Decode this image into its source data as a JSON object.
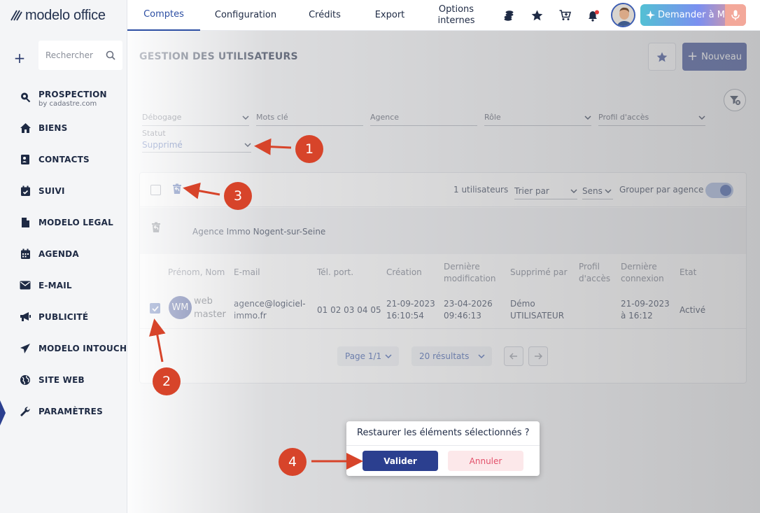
{
  "app": {
    "logo_text": "modelo office"
  },
  "sidebar": {
    "search_placeholder": "Rechercher",
    "items": [
      {
        "label": "PROSPECTION",
        "sub": "by cadastre.com",
        "icon": "map-search-icon"
      },
      {
        "label": "BIENS",
        "icon": "house-icon"
      },
      {
        "label": "CONTACTS",
        "icon": "contact-card-icon"
      },
      {
        "label": "SUIVI",
        "icon": "calendar-check-icon"
      },
      {
        "label": "MODELO LEGAL",
        "icon": "document-icon"
      },
      {
        "label": "AGENDA",
        "icon": "calendar-icon"
      },
      {
        "label": "E-MAIL",
        "icon": "envelope-icon"
      },
      {
        "label": "PUBLICITÉ",
        "icon": "megaphone-icon"
      },
      {
        "label": "MODELO INTOUCH",
        "icon": "paper-plane-icon"
      },
      {
        "label": "SITE WEB",
        "icon": "globe-icon"
      },
      {
        "label": "PARAMÈTRES",
        "icon": "wrench-icon"
      }
    ]
  },
  "topbar": {
    "tabs": [
      "Comptes",
      "Configuration",
      "Crédits",
      "Export",
      "Options internes"
    ],
    "active_tab": "Comptes",
    "mia_label": "Demander à MIA"
  },
  "page": {
    "title": "GESTION DES UTILISATEURS",
    "new_button": "Nouveau"
  },
  "filters": {
    "debogage": "Débogage",
    "mots_cle": "Mots clé",
    "agence": "Agence",
    "role": "Rôle",
    "profil": "Profil d'accès",
    "statut_label": "Statut",
    "statut_value": "Supprimé"
  },
  "table": {
    "count": "1 utilisateurs",
    "sort_label": "Trier par",
    "sens_label": "Sens",
    "group_label": "Grouper par agence :",
    "group_toggle": true,
    "agency": "Agence Immo Nogent-sur-Seine",
    "headers": {
      "name": "Prénom, Nom",
      "email": "E-mail",
      "phone": "Tél. port.",
      "created": "Création",
      "modified_1": "Dernière",
      "modified_2": "modification",
      "deleted_by": "Supprimé par",
      "profile_1": "Profil",
      "profile_2": "d'accès",
      "last_login_1": "Dernière",
      "last_login_2": "connexion",
      "state": "Etat"
    },
    "row": {
      "selected": true,
      "initials": "WM",
      "first_name": "web",
      "last_name": "master",
      "email_1": "agence@logiciel-",
      "email_2": "immo.fr",
      "phone": "01 02 03 04 05",
      "created_date": "21-09-2023",
      "created_time": "16:10:54",
      "modified_date": "23-04-2026",
      "modified_time": "09:46:13",
      "deleted_by_1": "Démo",
      "deleted_by_2": "UTILISATEUR",
      "last_login_date": "21-09-2023",
      "last_login_time": "à 16:12",
      "state": "Activé"
    },
    "pagination": {
      "page": "Page 1/1",
      "results": "20 résultats"
    }
  },
  "dialog": {
    "question": "Restaurer les éléments sélectionnés ?",
    "confirm": "Valider",
    "cancel": "Annuler"
  },
  "annotations": {
    "markers": [
      "1",
      "2",
      "3",
      "4"
    ],
    "color": "#d7442a"
  },
  "colors": {
    "primary": "#2b3f8f",
    "accent": "#2c4ea3",
    "cancel_text": "#e2506a"
  }
}
